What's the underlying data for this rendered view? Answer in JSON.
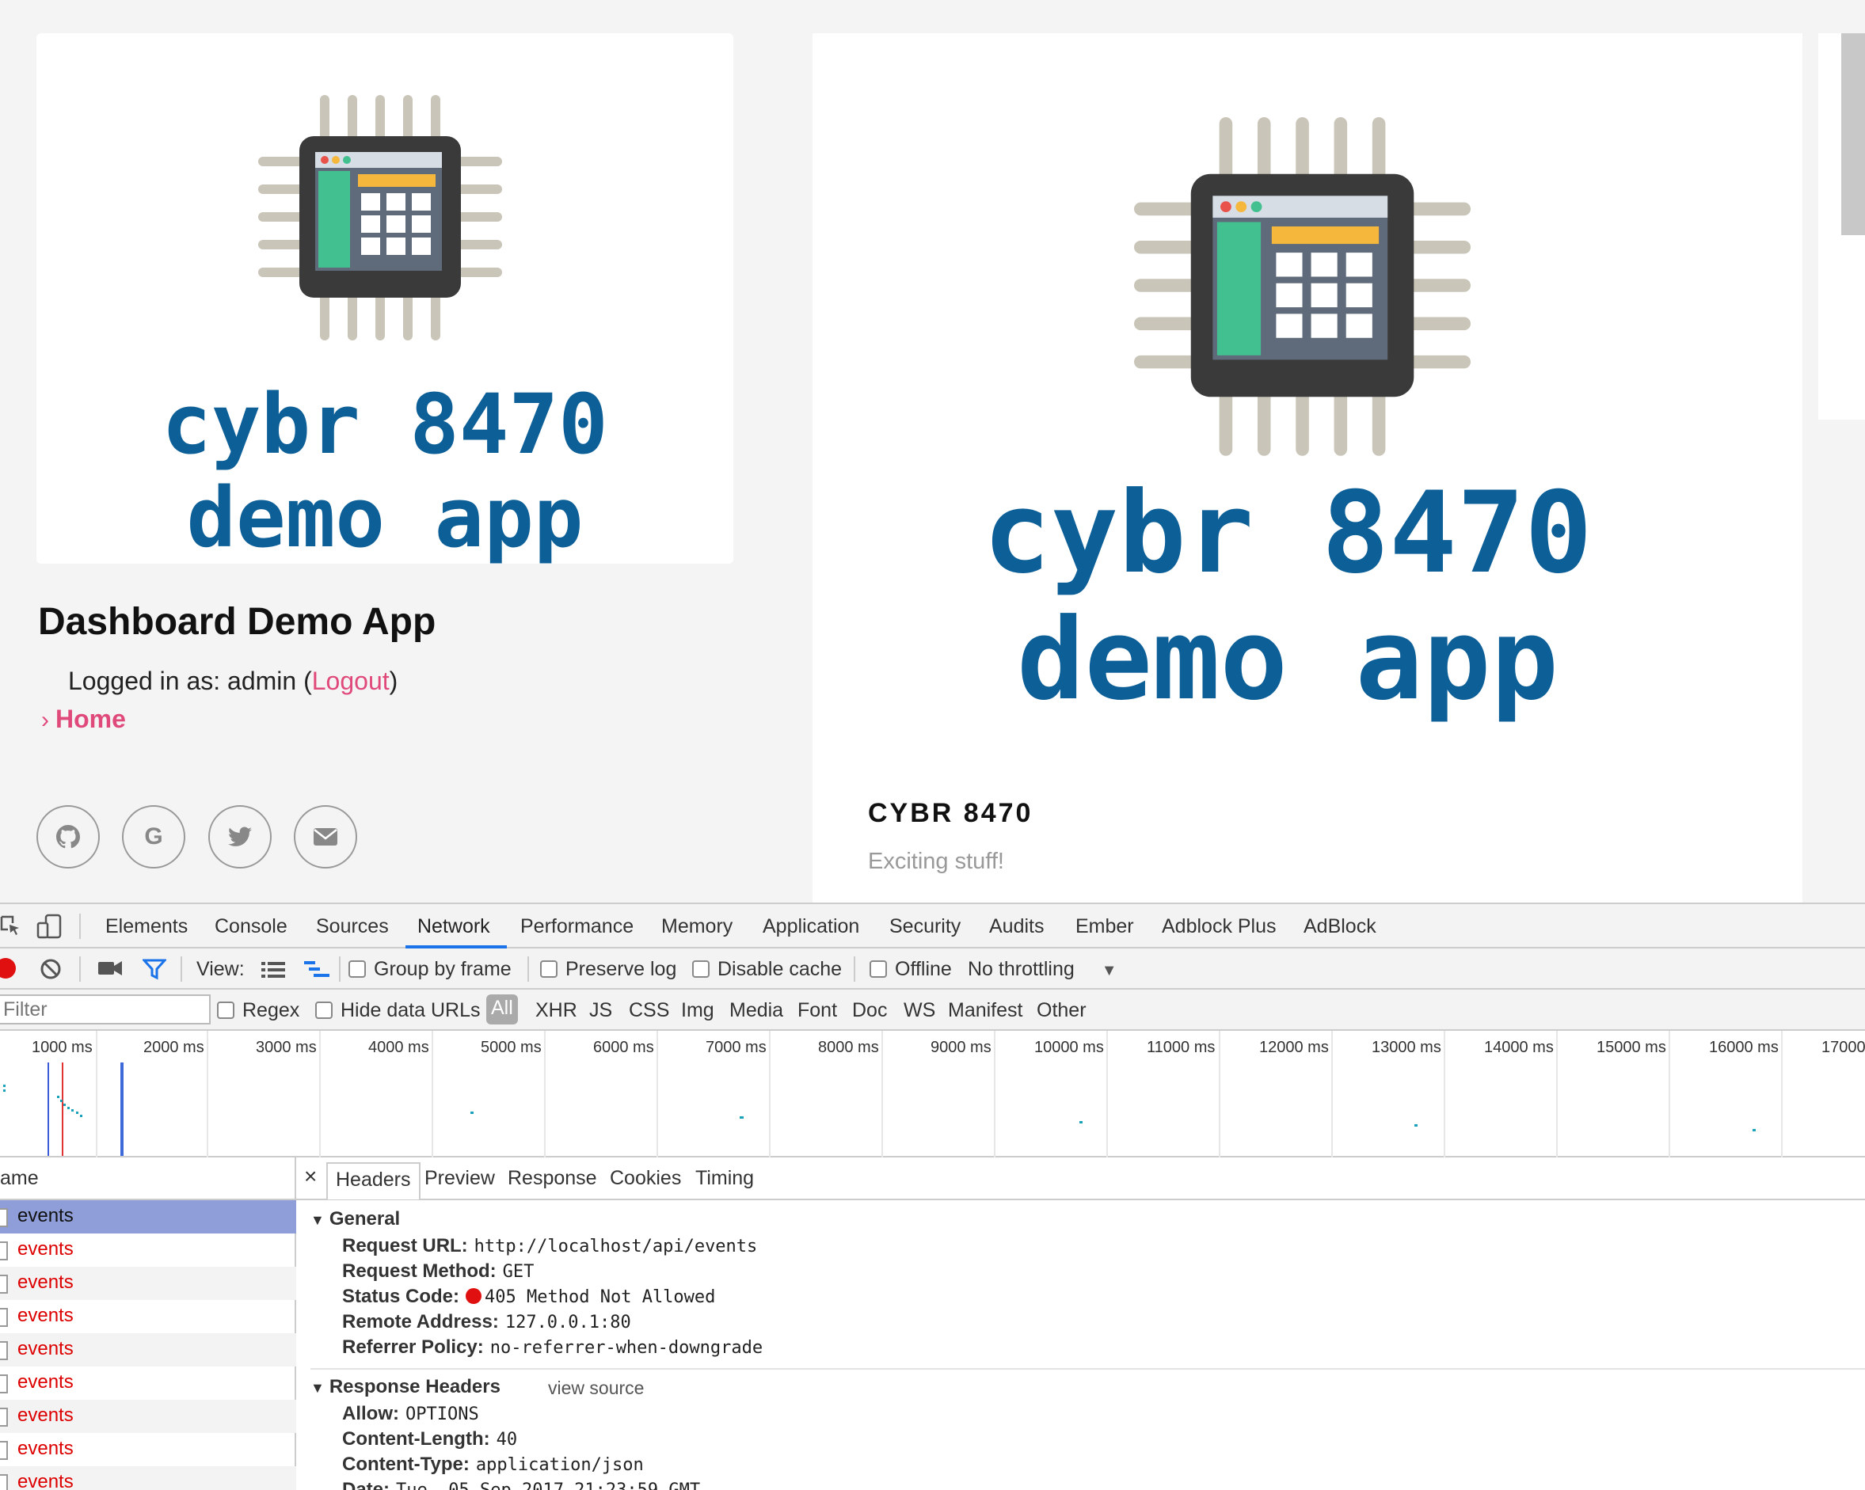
{
  "page": {
    "logo_text_line1": "cybr 8470",
    "logo_text_line2": "demo app",
    "site_title": "Dashboard Demo App",
    "logged_in_prefix": "Logged in as: admin (",
    "logout_label": "Logout",
    "logged_in_suffix": ")",
    "home_label": "Home",
    "social": [
      {
        "icon": "github-icon",
        "glyph": ""
      },
      {
        "icon": "google-icon",
        "glyph": "G"
      },
      {
        "icon": "twitter-icon",
        "glyph": ""
      },
      {
        "icon": "envelope-icon",
        "glyph": ""
      }
    ],
    "card_title": "CYBR 8470",
    "card_text": "Exciting stuff!",
    "colors": {
      "accent": "#e04a7a",
      "logo_blue": "#0d5f97"
    }
  },
  "devtools": {
    "tabs": [
      "Elements",
      "Console",
      "Sources",
      "Network",
      "Performance",
      "Memory",
      "Application",
      "Security",
      "Audits",
      "Ember",
      "Adblock Plus",
      "AdBlock"
    ],
    "active_tab": "Network",
    "toolbar": {
      "view_label": "View:",
      "group_by_frame": "Group by frame",
      "preserve_log": "Preserve log",
      "disable_cache": "Disable cache",
      "offline": "Offline",
      "throttling": "No throttling"
    },
    "filter": {
      "placeholder": "Filter",
      "regex": "Regex",
      "hide_data_urls": "Hide data URLs",
      "types": [
        "All",
        "XHR",
        "JS",
        "CSS",
        "Img",
        "Media",
        "Font",
        "Doc",
        "WS",
        "Manifest",
        "Other"
      ]
    },
    "timeline_labels": [
      "1000 ms",
      "2000 ms",
      "3000 ms",
      "4000 ms",
      "5000 ms",
      "6000 ms",
      "7000 ms",
      "8000 ms",
      "9000 ms",
      "10000 ms",
      "11000 ms",
      "12000 ms",
      "13000 ms",
      "14000 ms",
      "15000 ms",
      "16000 ms",
      "17000"
    ],
    "name_header": "ame",
    "requests": [
      "events",
      "events",
      "events",
      "events",
      "events",
      "events",
      "events",
      "events",
      "events"
    ],
    "detail_tabs": [
      "Headers",
      "Preview",
      "Response",
      "Cookies",
      "Timing"
    ],
    "close_glyph": "×",
    "general": {
      "title": "General",
      "request_url_label": "Request URL:",
      "request_url": "http://localhost/api/events",
      "request_method_label": "Request Method:",
      "request_method": "GET",
      "status_code_label": "Status Code:",
      "status_code": "405 Method Not Allowed",
      "remote_address_label": "Remote Address:",
      "remote_address": "127.0.0.1:80",
      "referrer_policy_label": "Referrer Policy:",
      "referrer_policy": "no-referrer-when-downgrade"
    },
    "response_headers": {
      "title": "Response Headers",
      "view_source": "view source",
      "allow_label": "Allow:",
      "allow": "OPTIONS",
      "content_length_label": "Content-Length:",
      "content_length": "40",
      "content_type_label": "Content-Type:",
      "content_type": "application/json",
      "date_label": "Date:",
      "date": "Tue, 05 Sep 2017 21:23:59 GMT"
    }
  }
}
